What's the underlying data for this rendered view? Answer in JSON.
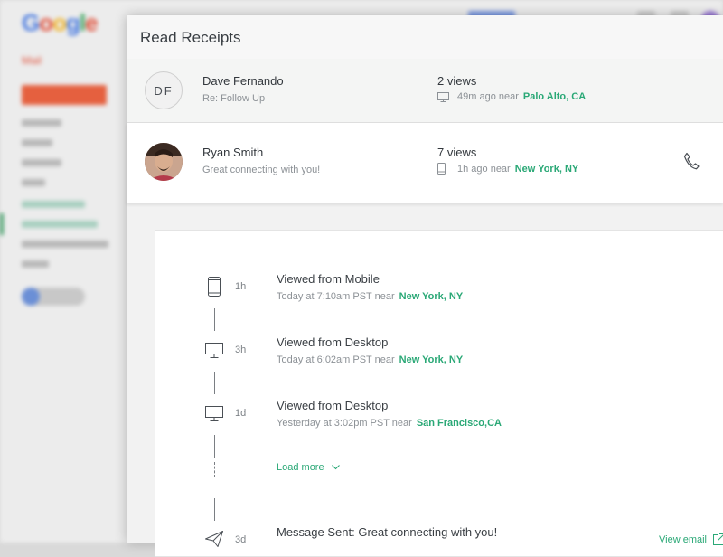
{
  "background": {
    "logo_letters": [
      "G",
      "o",
      "o",
      "g",
      "l",
      "e"
    ],
    "mail_label": "Mail"
  },
  "modal": {
    "title": "Read Receipts"
  },
  "receipts": [
    {
      "initials": "DF",
      "name": "Dave Fernando",
      "subject": "Re: Follow Up",
      "views": "2 views",
      "device_icon": "desktop-icon",
      "ago": "49m ago near",
      "location": "Palo Alto, CA"
    },
    {
      "avatar": "photo",
      "name": "Ryan Smith",
      "subject": "Great connecting with you!",
      "views": "7 views",
      "device_icon": "mobile-icon",
      "ago": "1h ago near",
      "location": "New York, NY",
      "action_icon": "phone-icon"
    }
  ],
  "timeline": {
    "events": [
      {
        "icon": "mobile-icon",
        "time": "1h",
        "title": "Viewed from Mobile",
        "detail": "Today at 7:10am PST near",
        "location": "New York, NY"
      },
      {
        "icon": "desktop-icon",
        "time": "3h",
        "title": "Viewed from Desktop",
        "detail": "Today at 6:02am PST near",
        "location": "New York, NY"
      },
      {
        "icon": "desktop-icon",
        "time": "1d",
        "title": "Viewed from Desktop",
        "detail": "Yesterday at 3:02pm PST near",
        "location": "San Francisco,CA"
      }
    ],
    "load_more": "Load more",
    "sent": {
      "icon": "send-icon",
      "time": "3d",
      "title": "Message Sent: Great connecting with you!",
      "link": "View email"
    }
  },
  "colors": {
    "accent": "#2aa876",
    "compose": "#e5603f"
  }
}
